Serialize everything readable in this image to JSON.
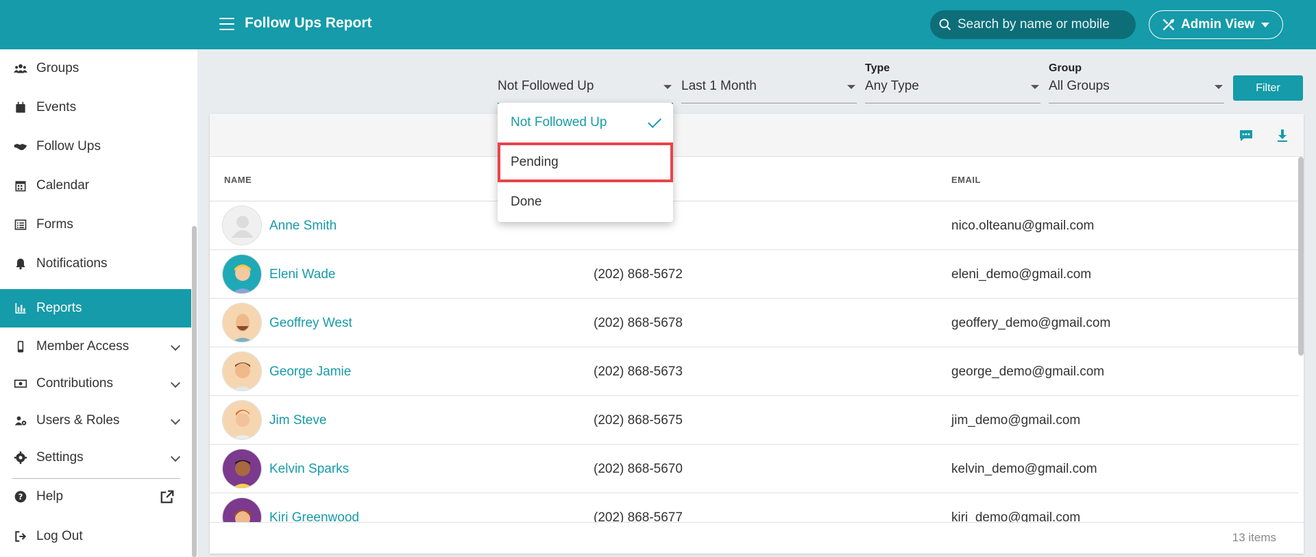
{
  "header": {
    "title": "Follow Ups Report",
    "search_placeholder": "Search by name or mobile",
    "admin_label": "Admin View"
  },
  "sidebar": {
    "items": [
      {
        "label": "Groups",
        "icon": "users-icon"
      },
      {
        "label": "Events",
        "icon": "calendar-day-icon"
      },
      {
        "label": "Follow Ups",
        "icon": "handshake-icon"
      },
      {
        "label": "Calendar",
        "icon": "calendar-icon"
      },
      {
        "label": "Forms",
        "icon": "list-icon"
      },
      {
        "label": "Notifications",
        "icon": "bell-icon"
      },
      {
        "label": "Reports",
        "icon": "chart-bar-icon",
        "active": true
      },
      {
        "label": "Member Access",
        "icon": "mobile-icon"
      },
      {
        "label": "Contributions",
        "icon": "money-icon"
      },
      {
        "label": "Users & Roles",
        "icon": "users-cog-icon"
      },
      {
        "label": "Settings",
        "icon": "gear-icon"
      },
      {
        "label": "Help",
        "icon": "question-circle-icon"
      },
      {
        "label": "Log Out",
        "icon": "sign-out-icon"
      }
    ]
  },
  "filters": {
    "status": {
      "value": "Not Followed Up"
    },
    "period": {
      "value": "Last 1 Month"
    },
    "type": {
      "label": "Type",
      "value": "Any Type"
    },
    "group": {
      "label": "Group",
      "value": "All Groups"
    },
    "button": "Filter"
  },
  "dropdown": {
    "options": [
      {
        "label": "Not Followed Up",
        "selected": true
      },
      {
        "label": "Pending",
        "highlighted": true
      },
      {
        "label": "Done"
      }
    ]
  },
  "table": {
    "columns": {
      "name": "NAME",
      "email": "EMAIL"
    },
    "rows": [
      {
        "name": "Anne Smith",
        "phone": "",
        "email": "nico.olteanu@gmail.com"
      },
      {
        "name": "Eleni Wade",
        "phone": "(202) 868-5672",
        "email": "eleni_demo@gmail.com"
      },
      {
        "name": "Geoffrey West",
        "phone": "(202) 868-5678",
        "email": "geoffery_demo@gmail.com"
      },
      {
        "name": "George Jamie",
        "phone": "(202) 868-5673",
        "email": "george_demo@gmail.com"
      },
      {
        "name": "Jim Steve",
        "phone": "(202) 868-5675",
        "email": "jim_demo@gmail.com"
      },
      {
        "name": "Kelvin Sparks",
        "phone": "(202) 868-5670",
        "email": "kelvin_demo@gmail.com"
      },
      {
        "name": "Kiri Greenwood",
        "phone": "(202) 868-5677",
        "email": "kiri_demo@gmail.com"
      }
    ],
    "count": "13 items"
  },
  "colors": {
    "accent": "#159ba9",
    "highlight": "#e8434b"
  }
}
